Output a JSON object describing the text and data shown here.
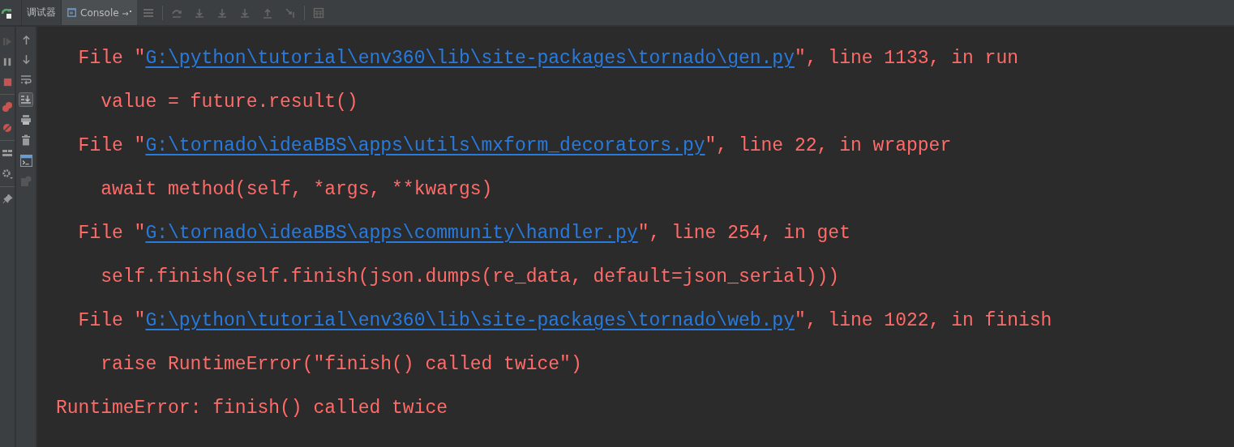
{
  "tabs": [
    {
      "label": "调试器",
      "selected": false,
      "kind": "text"
    },
    {
      "label": "Console",
      "selected": true,
      "kind": "console"
    }
  ],
  "console_lines": [
    {
      "kind": "file",
      "prefix": "File \"",
      "path": "G:\\python\\tutorial\\env360\\lib\\site-packages\\tornado\\gen.py",
      "suffix": "\", line 1133, in run"
    },
    {
      "kind": "code",
      "text": "value = future.result()"
    },
    {
      "kind": "file",
      "prefix": "File \"",
      "path": "G:\\tornado\\ideaBBS\\apps\\utils\\mxform_decorators.py",
      "suffix": "\", line 22, in wrapper"
    },
    {
      "kind": "code",
      "text": "await method(self, *args, **kwargs)"
    },
    {
      "kind": "file",
      "prefix": "File \"",
      "path": "G:\\tornado\\ideaBBS\\apps\\community\\handler.py",
      "suffix": "\", line 254, in get"
    },
    {
      "kind": "code",
      "text": "self.finish(self.finish(json.dumps(re_data, default=json_serial)))"
    },
    {
      "kind": "file",
      "prefix": "File \"",
      "path": "G:\\python\\tutorial\\env360\\lib\\site-packages\\tornado\\web.py",
      "suffix": "\", line 1022, in finish"
    },
    {
      "kind": "code",
      "text": "raise RuntimeError(\"finish() called twice\")"
    },
    {
      "kind": "error",
      "text": "RuntimeError: finish() called twice"
    }
  ]
}
